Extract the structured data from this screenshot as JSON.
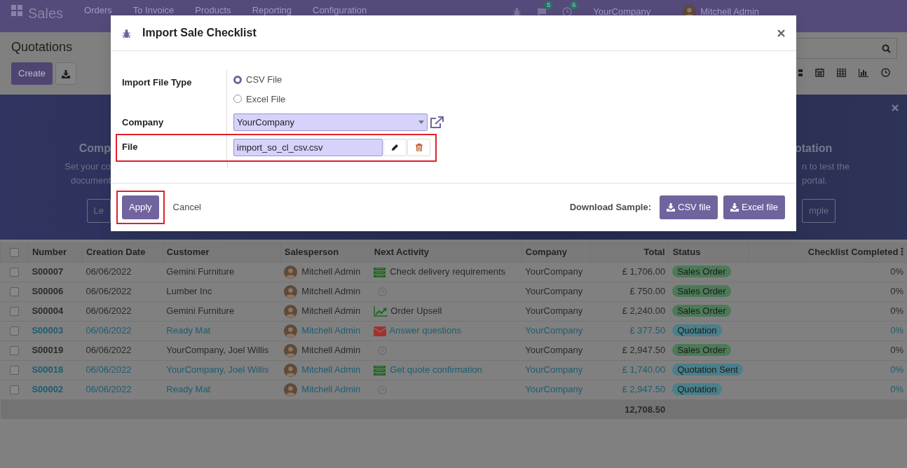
{
  "navbar": {
    "app": "Sales",
    "menu": [
      "Orders",
      "To Invoice",
      "Products",
      "Reporting",
      "Configuration"
    ],
    "message_count": "5",
    "activity_count": "6",
    "company": "YourCompany",
    "user": "Mitchell Admin"
  },
  "control_panel": {
    "title": "Quotations",
    "create": "Create"
  },
  "banner": {
    "left_title": "Comp",
    "left_lines": [
      "Set your co",
      "document"
    ],
    "left_button": "Le",
    "right_title": "otation",
    "right_lines": [
      "n to test the",
      "portal."
    ],
    "right_button": "mple"
  },
  "table": {
    "all_checked": false,
    "columns": [
      "Number",
      "Creation Date",
      "Customer",
      "Salesperson",
      "Next Activity",
      "Company",
      "Total",
      "Status",
      "Checklist Completed"
    ],
    "rows": [
      {
        "checked": false,
        "highlighted": false,
        "number": "S00007",
        "date": "06/06/2022",
        "customer": "Gemini Furniture",
        "salesperson": "Mitchell Admin",
        "activity": {
          "kind": "todo",
          "text": "Check delivery requirements"
        },
        "company": "YourCompany",
        "total": "£ 1,706.00",
        "status": {
          "label": "Sales Order",
          "color": "#4c7a57"
        },
        "checklist": "0%"
      },
      {
        "checked": false,
        "highlighted": false,
        "number": "S00006",
        "date": "06/06/2022",
        "customer": "Lumber Inc",
        "salesperson": "Mitchell Admin",
        "activity": {
          "kind": "none"
        },
        "company": "YourCompany",
        "total": "£ 750.00",
        "status": {
          "label": "Sales Order",
          "color": "#4c7a57"
        },
        "checklist": "0%"
      },
      {
        "checked": false,
        "highlighted": false,
        "number": "S00004",
        "date": "06/06/2022",
        "customer": "Gemini Furniture",
        "salesperson": "Mitchell Admin",
        "activity": {
          "kind": "upsell",
          "text": "Order Upsell"
        },
        "company": "YourCompany",
        "total": "£ 2,240.00",
        "status": {
          "label": "Sales Order",
          "color": "#4c7a57"
        },
        "checklist": "0%"
      },
      {
        "checked": false,
        "highlighted": true,
        "number": "S00003",
        "date": "06/06/2022",
        "customer": "Ready Mat",
        "salesperson": "Mitchell Admin",
        "activity": {
          "kind": "email",
          "text": "Answer questions"
        },
        "company": "YourCompany",
        "total": "£ 377.50",
        "status": {
          "label": "Quotation",
          "color": "#4a7f8b"
        },
        "checklist": "0%"
      },
      {
        "checked": false,
        "highlighted": false,
        "number": "S00019",
        "date": "06/06/2022",
        "customer": "YourCompany, Joel Willis",
        "salesperson": "Mitchell Admin",
        "activity": {
          "kind": "none"
        },
        "company": "YourCompany",
        "total": "£ 2,947.50",
        "status": {
          "label": "Sales Order",
          "color": "#4c7a57"
        },
        "checklist": "0%"
      },
      {
        "checked": false,
        "highlighted": true,
        "number": "S00018",
        "date": "06/06/2022",
        "customer": "YourCompany, Joel Willis",
        "salesperson": "Mitchell Admin",
        "activity": {
          "kind": "todo",
          "text": "Get quote confirmation"
        },
        "company": "YourCompany",
        "total": "£ 1,740.00",
        "status": {
          "label": "Quotation Sent",
          "color": "#4a7f8b"
        },
        "checklist": "0%"
      },
      {
        "checked": false,
        "highlighted": true,
        "number": "S00002",
        "date": "06/06/2022",
        "customer": "Ready Mat",
        "salesperson": "Mitchell Admin",
        "activity": {
          "kind": "none"
        },
        "company": "YourCompany",
        "total": "£ 2,947.50",
        "status": {
          "label": "Quotation",
          "color": "#4a7f8b"
        },
        "checklist": "0%"
      }
    ],
    "total": "12,708.50"
  },
  "dialog": {
    "title": "Import Sale Checklist",
    "file_type_label": "Import File Type",
    "file_types": [
      {
        "label": "CSV File",
        "selected": true
      },
      {
        "label": "Excel File",
        "selected": false
      }
    ],
    "company_label": "Company",
    "company": "YourCompany",
    "file_label": "File",
    "file": "import_so_cl_csv.csv",
    "apply": "Apply",
    "cancel": "Cancel",
    "sample_label": "Download Sample:",
    "samples": [
      "CSV file",
      "Excel file"
    ]
  }
}
